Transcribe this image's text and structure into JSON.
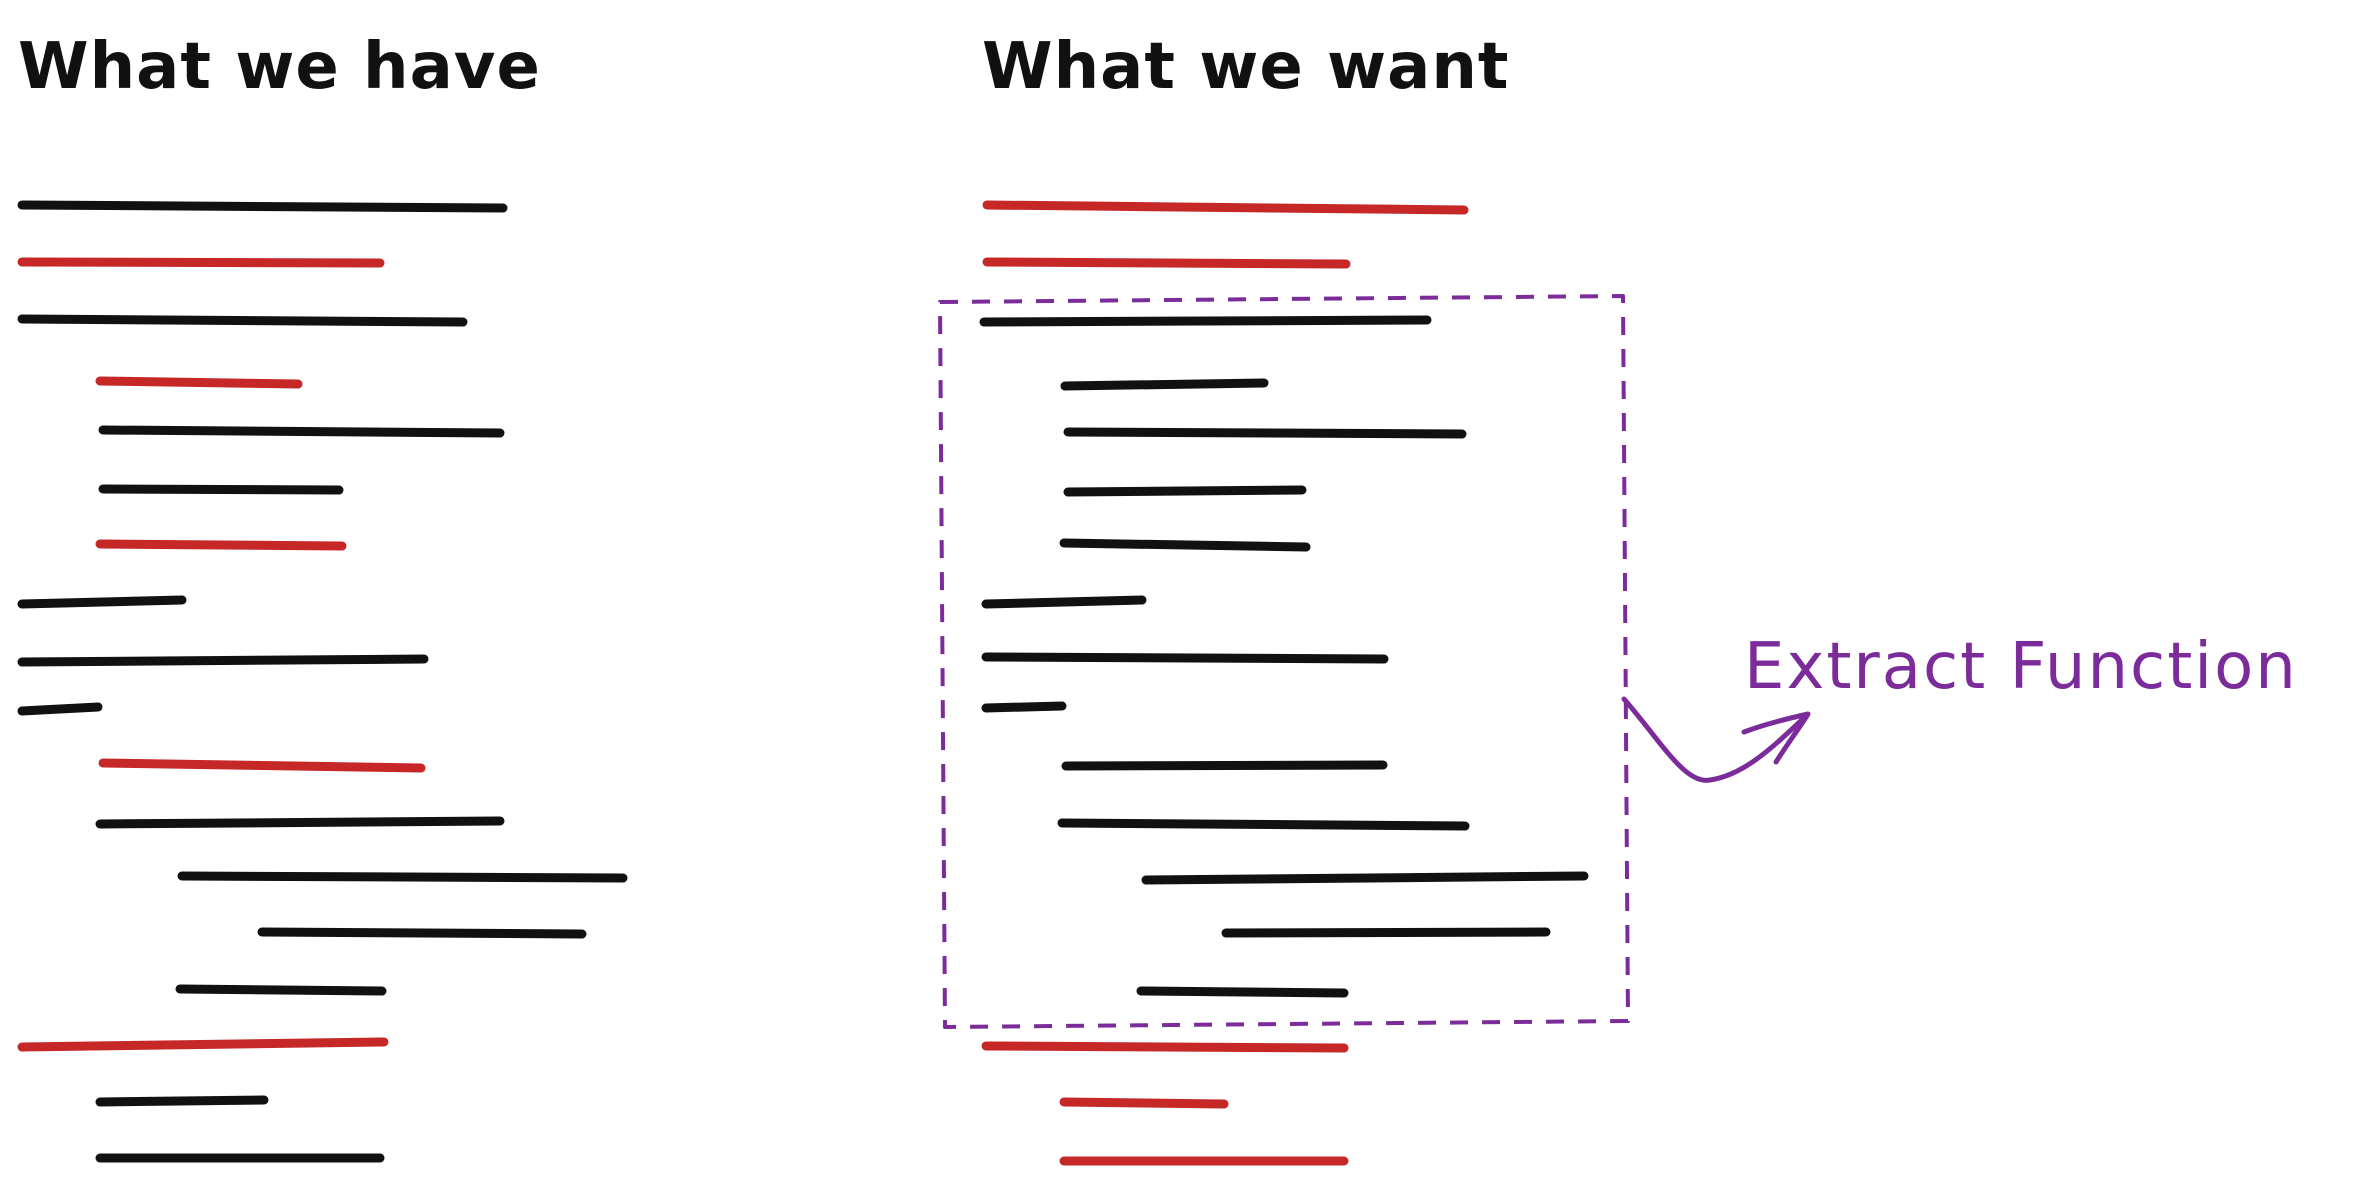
{
  "headings": {
    "left": "What we have",
    "right": "What we want"
  },
  "annotation": {
    "label": "Extract Function"
  },
  "colors": {
    "ink": "#111111",
    "highlight": "#c62828",
    "annotation": "#7b2c9a",
    "background": "#ffffff"
  },
  "legend_meaning": {
    "black_line": "code line",
    "red_line": "highlighted code line"
  },
  "panels": {
    "left": {
      "line_colors": [
        "black",
        "red",
        "black",
        "red",
        "black",
        "black",
        "red",
        "black",
        "black",
        "black",
        "red",
        "black",
        "black",
        "black",
        "black",
        "red",
        "black",
        "black"
      ]
    },
    "right": {
      "line_colors": [
        "red",
        "red",
        "black",
        "black",
        "black",
        "black",
        "black",
        "black",
        "black",
        "black",
        "black",
        "black",
        "black",
        "black",
        "black",
        "red",
        "red",
        "red"
      ],
      "selected_range": {
        "first": 3,
        "last": 15
      }
    }
  }
}
